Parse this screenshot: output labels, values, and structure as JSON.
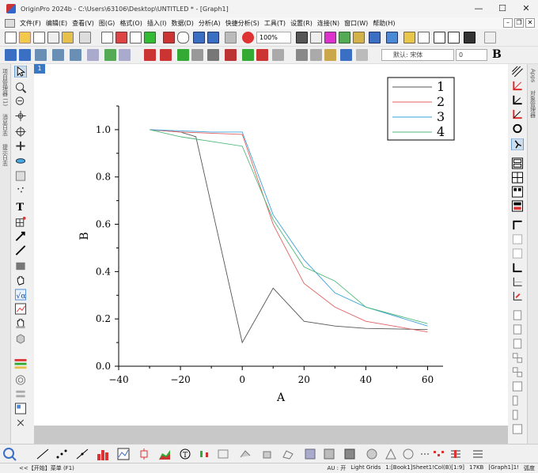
{
  "window": {
    "title": "OriginPro 2024b - C:\\Users\\63106\\Desktop\\UNTITLED * - [Graph1]",
    "minimize": "—",
    "maximize": "☐",
    "close": "✕"
  },
  "menu": [
    "文件(F)",
    "编辑(E)",
    "查看(V)",
    "图(G)",
    "格式(O)",
    "插入(I)",
    "数据(D)",
    "分析(A)",
    "快捷分析(S)",
    "工具(T)",
    "设置(R)",
    "连接(N)",
    "窗口(W)",
    "帮助(H)"
  ],
  "toolbar": {
    "zoom": "100%",
    "font_name": "默认: 宋体",
    "font_size": "0",
    "bold": "B"
  },
  "left_dock": {
    "tabs": [
      "项目管理器 (1)",
      "消息日志",
      "提示日志"
    ]
  },
  "right_dock": {
    "tabs": [
      "Apps",
      "对象管理器"
    ]
  },
  "page_badge": "1",
  "status": {
    "left": "<<【开始】菜单 (F1)",
    "au": "AU : 开",
    "grids": "Light Grids",
    "sheet": "1:[Book1]Sheet1!Col(B)[1:9]",
    "size": "17KB",
    "graph": "[Graph1]1!",
    "angle": "弧度"
  },
  "chart_data": {
    "type": "line",
    "xlabel": "A",
    "ylabel": "B",
    "xlim": [
      -40,
      65
    ],
    "ylim": [
      0.0,
      1.1
    ],
    "xticks": [
      -40,
      -20,
      0,
      20,
      40,
      60
    ],
    "xtick_labels": [
      "−40",
      "−20",
      "0",
      "20",
      "40",
      "60"
    ],
    "yticks": [
      0.0,
      0.2,
      0.4,
      0.6,
      0.8,
      1.0
    ],
    "ytick_labels": [
      "0.0",
      "0.2",
      "0.4",
      "0.6",
      "0.8",
      "1.0"
    ],
    "legend_position": "top-right",
    "series": [
      {
        "name": "1",
        "color": "#555555",
        "x": [
          -30,
          -20,
          -15,
          0,
          10,
          20,
          30,
          40,
          60
        ],
        "y": [
          1.0,
          0.99,
          0.97,
          0.1,
          0.33,
          0.19,
          0.17,
          0.16,
          0.155
        ]
      },
      {
        "name": "2",
        "color": "#e06060",
        "x": [
          -30,
          -20,
          -10,
          0,
          10,
          20,
          30,
          40,
          60
        ],
        "y": [
          1.0,
          0.99,
          0.985,
          0.98,
          0.6,
          0.35,
          0.25,
          0.19,
          0.145
        ]
      },
      {
        "name": "3",
        "color": "#3aa0d8",
        "x": [
          -30,
          -20,
          -10,
          0,
          10,
          20,
          30,
          40,
          60
        ],
        "y": [
          1.0,
          0.995,
          0.99,
          0.99,
          0.64,
          0.45,
          0.31,
          0.25,
          0.17
        ]
      },
      {
        "name": "4",
        "color": "#50b878",
        "x": [
          -30,
          -20,
          -10,
          0,
          10,
          20,
          30,
          40,
          60
        ],
        "y": [
          1.0,
          0.97,
          0.95,
          0.93,
          0.62,
          0.42,
          0.36,
          0.25,
          0.18
        ]
      }
    ]
  }
}
